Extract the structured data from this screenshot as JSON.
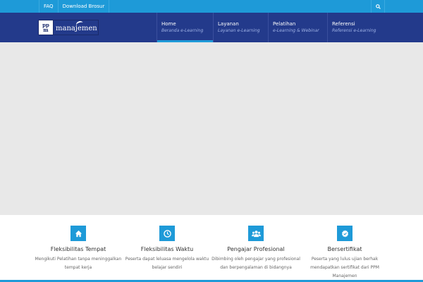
{
  "topbar": {
    "links": [
      "FAQ",
      "Download Brosur"
    ],
    "search_icon": "search-icon"
  },
  "logo": {
    "box_letters": [
      "pp",
      "m"
    ],
    "word": "manajemen"
  },
  "nav": [
    {
      "title": "Home",
      "subtitle": "Beranda e-Learning",
      "active": true
    },
    {
      "title": "Layanan",
      "subtitle": "Layanan e-Learning",
      "active": false
    },
    {
      "title": "Pelatihan",
      "subtitle": "e-Learning & Webinar",
      "active": false
    },
    {
      "title": "Referensi",
      "subtitle": "Referensi e-Learning",
      "active": false
    }
  ],
  "features": [
    {
      "icon": "home-icon",
      "title": "Fleksibilitas Tempat",
      "desc": "Mengikuti Pelatihan tanpa meninggalkan tempat kerja"
    },
    {
      "icon": "clock-icon",
      "title": "Fleksibilitas Waktu",
      "desc": "Peserta dapat leluasa mengelola waktu belajar sendiri"
    },
    {
      "icon": "users-icon",
      "title": "Pengajar Profesional",
      "desc": "Dibimbing oleh pengajar yang profesional dan berpengalaman di bidangnya"
    },
    {
      "icon": "certificate-icon",
      "title": "Bersertifikat",
      "desc": "Peserta yang lulus ujian berhak mendapatkan sertifikat dari PPM Manajemen"
    }
  ],
  "colors": {
    "topbar": "#1e9ad8",
    "header": "#233a8b",
    "hero": "#e8e8e8",
    "accent": "#1e9ad8"
  }
}
